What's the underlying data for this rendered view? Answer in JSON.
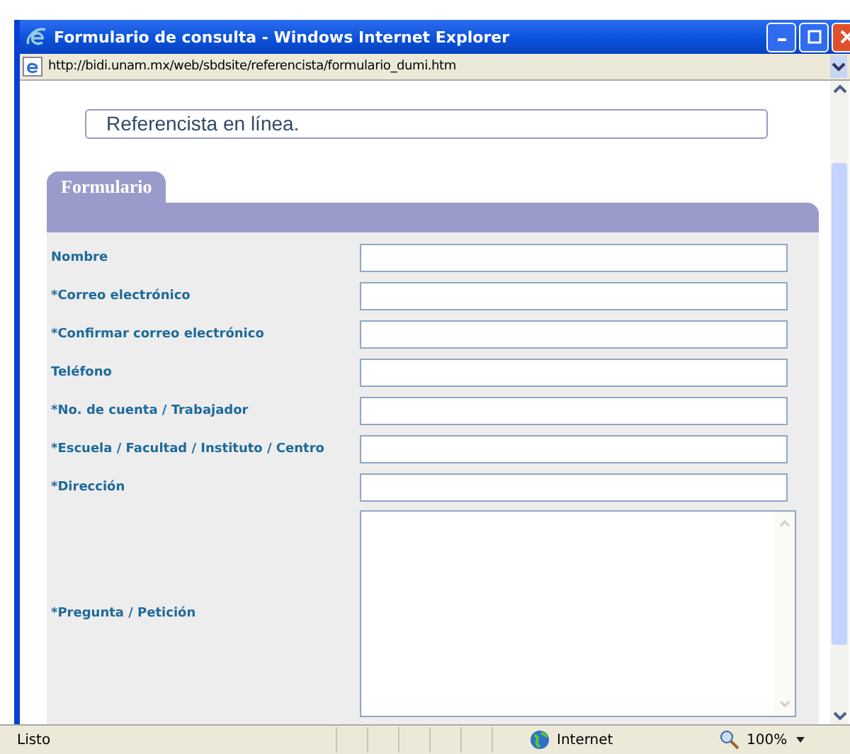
{
  "window": {
    "title": "Formulario de consulta - Windows Internet Explorer"
  },
  "address_bar": {
    "url": "http://bidi.unam.mx/web/sbdsite/referencista/formulario_dumi.htm"
  },
  "page": {
    "heading": "Referencista en línea.",
    "tab": "Formulario",
    "fields": [
      {
        "label": "Nombre",
        "kind": "text"
      },
      {
        "label": "*Correo electrónico",
        "kind": "text"
      },
      {
        "label": "*Confirmar correo electrónico",
        "kind": "text"
      },
      {
        "label": "Teléfono",
        "kind": "text"
      },
      {
        "label": "*No. de cuenta / Trabajador",
        "kind": "text"
      },
      {
        "label": "*Escuela / Facultad / Instituto / Centro",
        "kind": "text"
      },
      {
        "label": "*Dirección",
        "kind": "text"
      },
      {
        "label": "*Pregunta / Petición",
        "kind": "textarea"
      }
    ]
  },
  "status_bar": {
    "status": "Listo",
    "zone": "Internet",
    "zoom": "100%"
  }
}
